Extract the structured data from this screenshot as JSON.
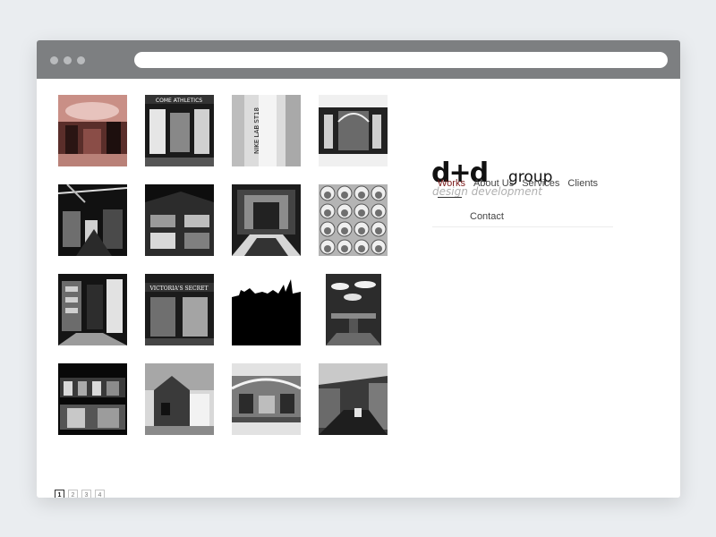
{
  "browser": {
    "address_value": ""
  },
  "logo": {
    "mark": "d+d",
    "group": "group",
    "tagline": "design development"
  },
  "nav": {
    "items": [
      {
        "label": "Works",
        "active": true
      },
      {
        "label": "About Us",
        "active": false
      },
      {
        "label": "Services",
        "active": false
      },
      {
        "label": "Clients",
        "active": false
      },
      {
        "label": "Contact",
        "active": false
      }
    ]
  },
  "gallery": {
    "thumbnails": [
      {
        "subject": "store-interior-red-tint"
      },
      {
        "subject": "come-athletics-storefront"
      },
      {
        "subject": "nike-lab-sign"
      },
      {
        "subject": "arched-storefront"
      },
      {
        "subject": "store-interior-lights"
      },
      {
        "subject": "corner-building-night"
      },
      {
        "subject": "patterned-floor-entrance"
      },
      {
        "subject": "circular-display-wall"
      },
      {
        "subject": "retail-display-shelves"
      },
      {
        "subject": "victorias-secret-storefront"
      },
      {
        "subject": "city-skyline-silhouette"
      },
      {
        "subject": "round-pendant-lights"
      },
      {
        "subject": "fashion-store-night"
      },
      {
        "subject": "modern-house-exterior"
      },
      {
        "subject": "mall-atrium"
      },
      {
        "subject": "library-reading-room"
      }
    ],
    "image_text": {
      "come_athletics": "COME ATHLETICS",
      "nike_lab": "NIKE LAB ST18",
      "victorias_secret": "VICTORIA'S SECRET"
    }
  },
  "pagination": {
    "pages": [
      "1",
      "2",
      "3",
      "4"
    ],
    "current": "1"
  },
  "colors": {
    "accent": "#7a1a1a",
    "titlebar": "#7d7f81",
    "background": "#eaedf0"
  }
}
